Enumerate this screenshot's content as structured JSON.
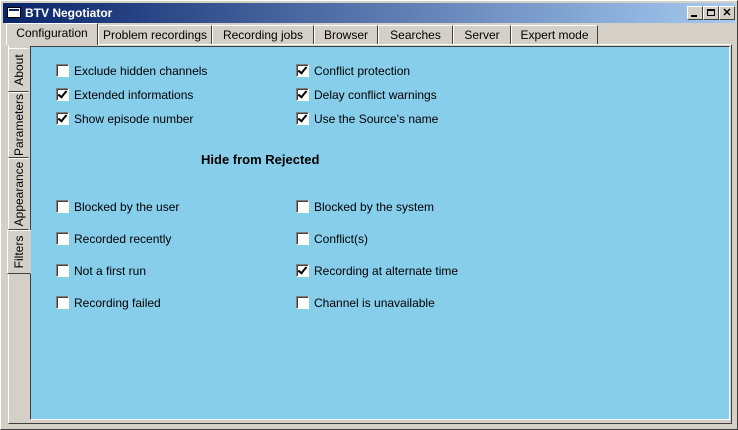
{
  "window": {
    "title": "BTV Negotiator"
  },
  "top_tabs": [
    "Configuration",
    "Problem recordings",
    "Recording jobs",
    "Browser",
    "Searches",
    "Server",
    "Expert mode"
  ],
  "active_top_tab": "Configuration",
  "side_tabs": [
    "About",
    "Parameters",
    "Appearance",
    "Filters"
  ],
  "active_side_tab": "Filters",
  "options": {
    "exclude_hidden_channels": {
      "label": "Exclude hidden channels",
      "checked": false
    },
    "extended_informations": {
      "label": "Extended informations",
      "checked": true
    },
    "show_episode_number": {
      "label": "Show episode number",
      "checked": true
    },
    "conflict_protection": {
      "label": "Conflict protection",
      "checked": true
    },
    "delay_conflict_warnings": {
      "label": "Delay conflict warnings",
      "checked": true
    },
    "use_sources_name": {
      "label": "Use the Source's name",
      "checked": true
    }
  },
  "hide_from_rejected": {
    "title": "Hide from Rejected",
    "blocked_by_user": {
      "label": "Blocked by the user",
      "checked": false
    },
    "recorded_recently": {
      "label": "Recorded recently",
      "checked": false
    },
    "not_first_run": {
      "label": "Not a first run",
      "checked": false
    },
    "recording_failed": {
      "label": "Recording failed",
      "checked": false
    },
    "blocked_by_system": {
      "label": "Blocked by the system",
      "checked": false
    },
    "conflicts": {
      "label": "Conflict(s)",
      "checked": false
    },
    "alternate_time": {
      "label": "Recording at alternate time",
      "checked": true
    },
    "channel_unavailable": {
      "label": "Channel is unavailable",
      "checked": false
    }
  }
}
